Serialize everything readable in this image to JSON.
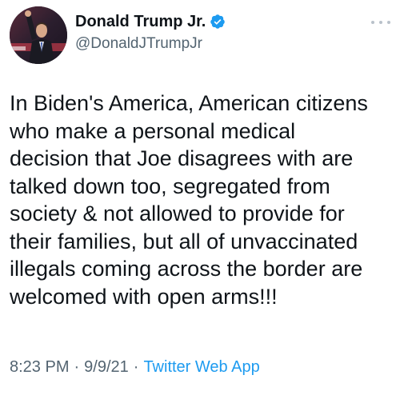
{
  "author": {
    "display_name": "Donald Trump Jr.",
    "handle": "@DonaldJTrumpJr",
    "verified": true,
    "verified_color": "#1d9bf0",
    "avatar_icon": "profile-photo"
  },
  "tweet": {
    "text": "In Biden's America, American citizens\nwho make a personal medical\ndecision that Joe disagrees with are\ntalked down too, segregated from\nsociety & not allowed to provide for\ntheir families, but all of unvaccinated\nillegals coming across the border are\nwelcomed with open arms!!!"
  },
  "meta": {
    "time": "8:23 PM",
    "separator_1": "·",
    "date": "9/9/21",
    "separator_2": "·",
    "source": "Twitter Web App"
  },
  "colors": {
    "text": "#0f1419",
    "secondary": "#536471",
    "link": "#1d9bf0"
  },
  "icons": {
    "more": "more-horizontal-icon",
    "verified": "verified-badge-icon"
  }
}
